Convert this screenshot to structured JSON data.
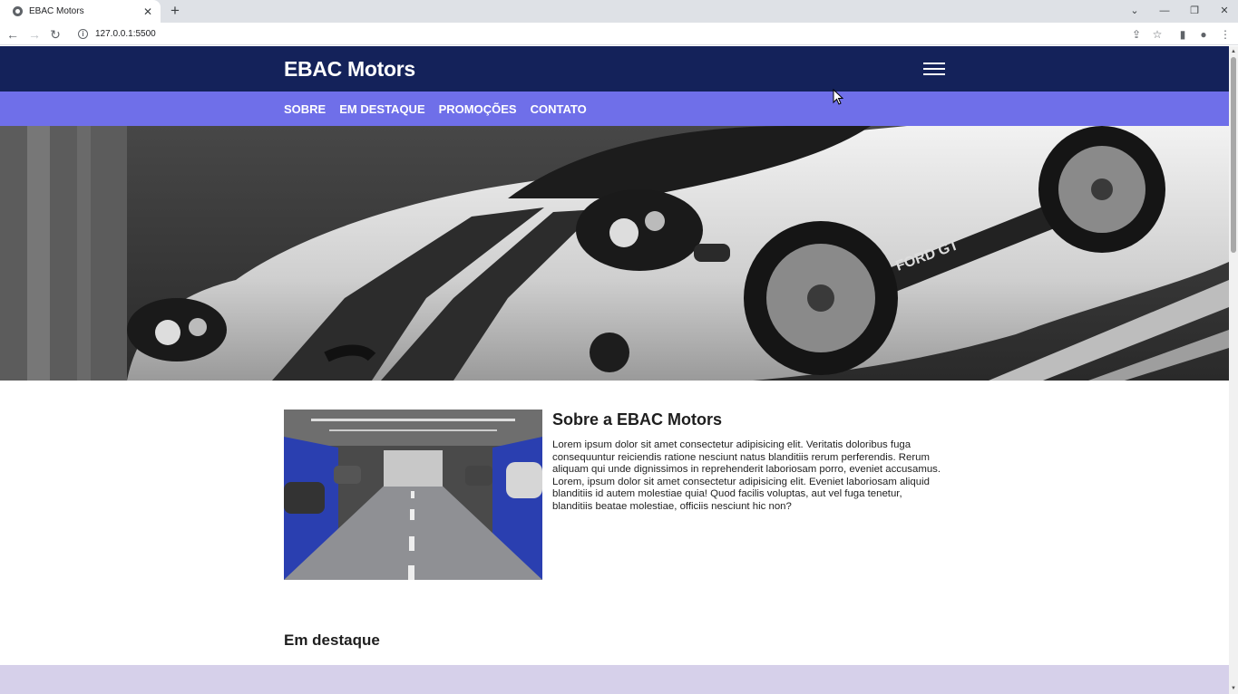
{
  "browser": {
    "tab_title": "EBAC Motors",
    "close_tab_glyph": "✕",
    "new_tab_glyph": "+",
    "url": "127.0.0.1:5500",
    "window_controls": {
      "tab_search": "⌄",
      "minimize": "—",
      "restore": "❐",
      "close": "✕"
    },
    "icons": {
      "back": "←",
      "forward": "→",
      "reload": "↻",
      "share": "⇪",
      "bookmark": "☆",
      "sidepanel": "▮",
      "profile": "●",
      "menu": "⋮"
    }
  },
  "site": {
    "logo": "EBAC Motors",
    "nav": [
      {
        "label": "SOBRE"
      },
      {
        "label": "EM DESTAQUE"
      },
      {
        "label": "PROMOÇÕES"
      },
      {
        "label": "CONTATO"
      }
    ],
    "about": {
      "title": "Sobre a EBAC Motors",
      "text": "Lorem ipsum dolor sit amet consectetur adipisicing elit. Veritatis doloribus fuga consequuntur reiciendis ratione nesciunt natus blanditiis rerum perferendis. Rerum aliquam qui unde dignissimos in reprehenderit laboriosam porro, eveniet accusamus. Lorem, ipsum dolor sit amet consectetur adipisicing elit. Eveniet laboriosam aliquid blanditiis id autem molestiae quia! Quod facilis voluptas, aut vel fuga tenetur, blanditiis beatae molestiae, officiis nesciunt hic non?"
    },
    "featured_title": "Em destaque"
  },
  "colors": {
    "header_bg": "#14225a",
    "nav_bg": "#6f6fe9",
    "featured_band": "#d6d0ea"
  }
}
